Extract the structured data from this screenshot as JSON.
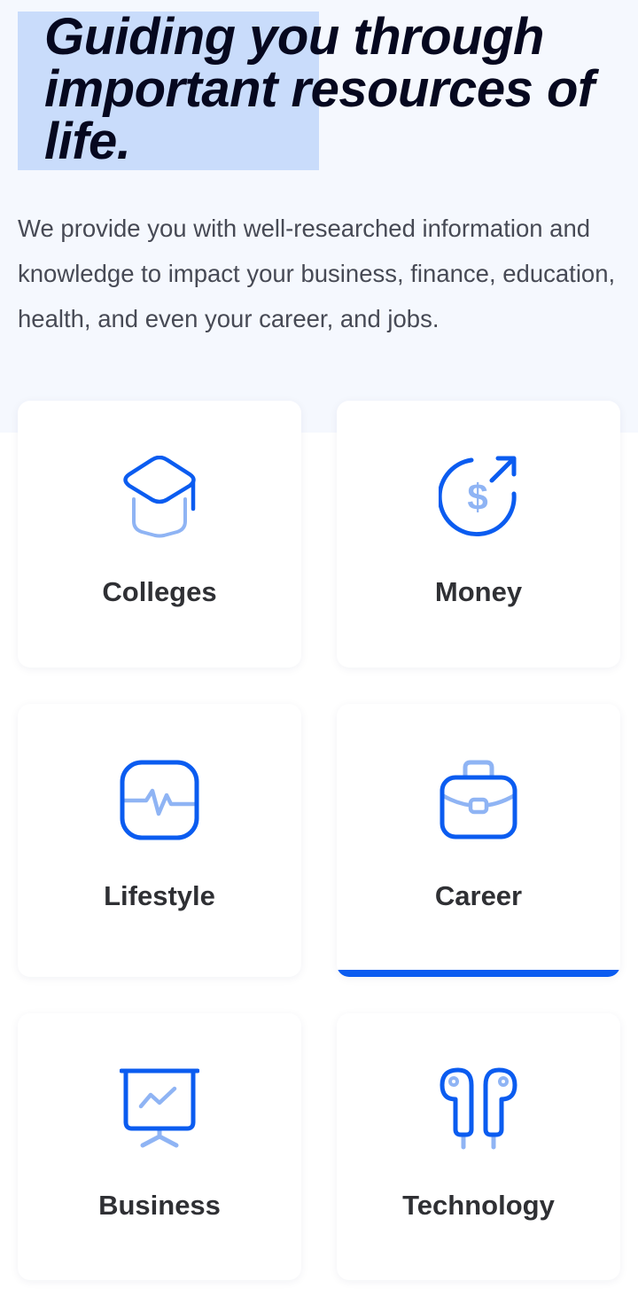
{
  "hero": {
    "headline": "Guiding you through important resources of life.",
    "intro": "We provide you with well-researched information and knowledge to impact your business, finance, education, health, and even your career, and jobs."
  },
  "colors": {
    "accent": "#0b5cf0",
    "accent_light": "#8fb4f4",
    "highlight": "#c9dcfb",
    "hero_background": "#f5f8fe"
  },
  "categories": [
    {
      "label": "Colleges",
      "icon": "graduation-cap-icon",
      "active": false
    },
    {
      "label": "Money",
      "icon": "dollar-growth-icon",
      "active": false
    },
    {
      "label": "Lifestyle",
      "icon": "heartbeat-icon",
      "active": false
    },
    {
      "label": "Career",
      "icon": "briefcase-icon",
      "active": true
    },
    {
      "label": "Business",
      "icon": "presentation-board-icon",
      "active": false
    },
    {
      "label": "Technology",
      "icon": "earbuds-icon",
      "active": false
    }
  ]
}
